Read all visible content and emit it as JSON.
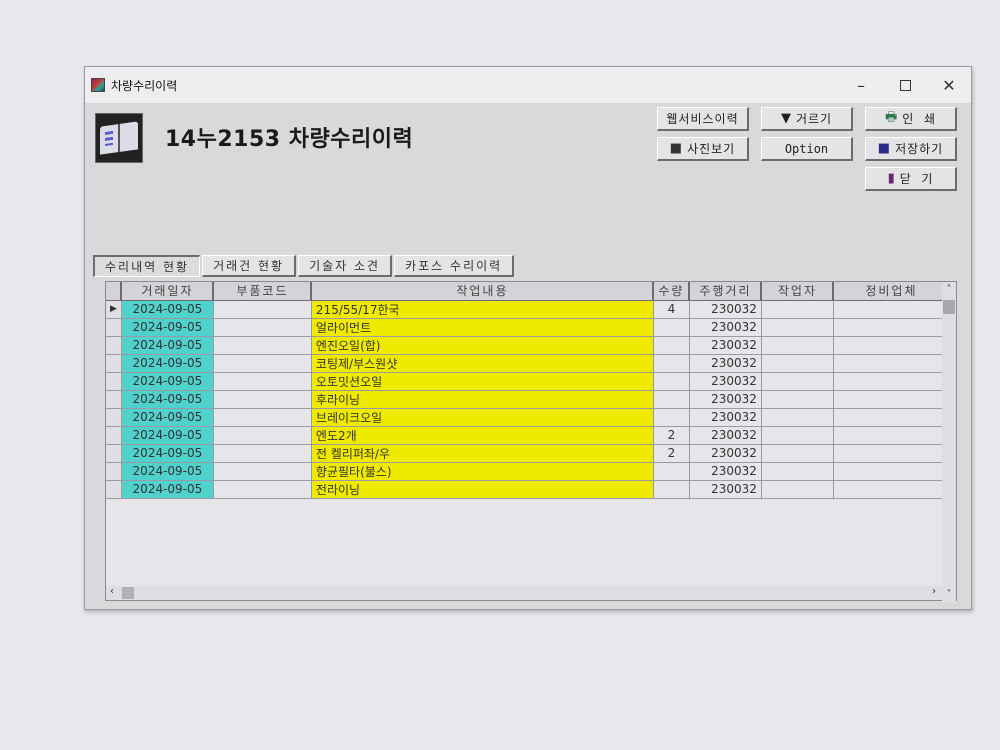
{
  "window": {
    "title": "차량수리이력",
    "controls": {
      "minimize": "–",
      "close": "✕"
    }
  },
  "header": {
    "page_title": "14누2153 차량수리이력",
    "icon": "book-icon"
  },
  "toolbar": {
    "web_service_history": "웹서비스이력",
    "filter": "거르기",
    "print": "인  쇄",
    "view_photos": "사진보기",
    "option": "Option",
    "save": "저장하기",
    "close": "닫  기",
    "icons": {
      "filter": "funnel-icon",
      "print": "printer-icon",
      "photos": "camera-icon",
      "save": "floppy-disk-icon",
      "close": "door-exit-icon"
    }
  },
  "tabs": [
    {
      "label": "수리내역 현황",
      "active": true
    },
    {
      "label": "거래건 현황",
      "active": false
    },
    {
      "label": "기술자 소견",
      "active": false
    },
    {
      "label": "카포스 수리이력",
      "active": false
    }
  ],
  "grid": {
    "columns": [
      "거래일자",
      "부품코드",
      "작업내용",
      "수량",
      "주행거리",
      "작업자",
      "정비업체"
    ],
    "rows": [
      {
        "date": "2024-09-05",
        "part_code": "",
        "work": "215/55/17한국",
        "qty": "4",
        "mileage": "230032",
        "worker": "",
        "shop": "",
        "current": true
      },
      {
        "date": "2024-09-05",
        "part_code": "",
        "work": "얼라이먼트",
        "qty": "",
        "mileage": "230032",
        "worker": "",
        "shop": ""
      },
      {
        "date": "2024-09-05",
        "part_code": "",
        "work": "엔진오일(합)",
        "qty": "",
        "mileage": "230032",
        "worker": "",
        "shop": ""
      },
      {
        "date": "2024-09-05",
        "part_code": "",
        "work": "코팅제/부스원샷",
        "qty": "",
        "mileage": "230032",
        "worker": "",
        "shop": ""
      },
      {
        "date": "2024-09-05",
        "part_code": "",
        "work": "오토밋션오일",
        "qty": "",
        "mileage": "230032",
        "worker": "",
        "shop": ""
      },
      {
        "date": "2024-09-05",
        "part_code": "",
        "work": "후라이닝",
        "qty": "",
        "mileage": "230032",
        "worker": "",
        "shop": ""
      },
      {
        "date": "2024-09-05",
        "part_code": "",
        "work": "브레이크오일",
        "qty": "",
        "mileage": "230032",
        "worker": "",
        "shop": ""
      },
      {
        "date": "2024-09-05",
        "part_code": "",
        "work": "엔도2개",
        "qty": "2",
        "mileage": "230032",
        "worker": "",
        "shop": ""
      },
      {
        "date": "2024-09-05",
        "part_code": "",
        "work": "전 켈리퍼좌/우",
        "qty": "2",
        "mileage": "230032",
        "worker": "",
        "shop": ""
      },
      {
        "date": "2024-09-05",
        "part_code": "",
        "work": "향균필타(불스)",
        "qty": "",
        "mileage": "230032",
        "worker": "",
        "shop": ""
      },
      {
        "date": "2024-09-05",
        "part_code": "",
        "work": "전라이닝",
        "qty": "",
        "mileage": "230032",
        "worker": "",
        "shop": ""
      }
    ],
    "colors": {
      "date_cell": "#4fd1cc",
      "work_cell": "#f0ea00"
    }
  },
  "scrollbars": {
    "up": "˄",
    "down": "˅",
    "left": "‹",
    "right": "›"
  }
}
